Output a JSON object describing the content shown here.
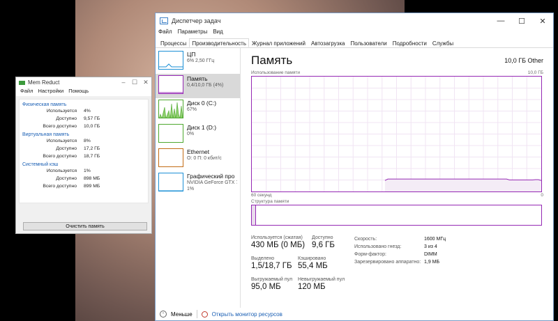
{
  "taskmgr": {
    "title": "Диспетчер задач",
    "menu": [
      "Файл",
      "Параметры",
      "Вид"
    ],
    "tabs": [
      "Процессы",
      "Производительность",
      "Журнал приложений",
      "Автозагрузка",
      "Пользователи",
      "Подробности",
      "Службы"
    ],
    "active_tab": "Производительность",
    "sidebar": [
      {
        "name": "ЦП",
        "sub": "6% 2,50 ГГц",
        "sub2": "",
        "color": "#1a8fd6"
      },
      {
        "name": "Память",
        "sub": "0,4/10,0 ГБ (4%)",
        "sub2": "",
        "color": "#9528b4"
      },
      {
        "name": "Диск 0 (C:)",
        "sub": "67%",
        "sub2": "",
        "color": "#4da82e"
      },
      {
        "name": "Диск 1 (D:)",
        "sub": "0%",
        "sub2": "",
        "color": "#4da82e"
      },
      {
        "name": "Ethernet",
        "sub": "О: 0 П: 0 кбит/с",
        "sub2": "",
        "color": "#c26b14"
      },
      {
        "name": "Графический про",
        "sub": "NVIDIA GeForce GTX 76(",
        "sub2": "1%",
        "color": "#1a8fd6"
      }
    ],
    "main": {
      "title": "Память",
      "capacity": "10,0 ГБ Other",
      "graph_label": "Использование памяти",
      "graph_max": "10,0 ГБ",
      "graph_time": "60 секунд",
      "graph_min": "0",
      "struct_label": "Структура памяти"
    },
    "stats": {
      "in_use_label": "Используется (сжатая)",
      "in_use_value": "430 МБ (0 МБ)",
      "available_label": "Доступно",
      "available_value": "9,6 ГБ",
      "committed_label": "Выделено",
      "committed_value": "1,5/18,7 ГБ",
      "cached_label": "Кэшировано",
      "cached_value": "55,4 МБ",
      "paged_label": "Выгружаемый пул",
      "paged_value": "95,0 МБ",
      "nonpaged_label": "Невыгружаемый пул",
      "nonpaged_value": "120 МБ"
    },
    "details": [
      {
        "k": "Скорость:",
        "v": "1600 МГц"
      },
      {
        "k": "Использовано гнезд:",
        "v": "3 из 4"
      },
      {
        "k": "Форм-фактор:",
        "v": "DIMM"
      },
      {
        "k": "Зарезервировано аппаратно:",
        "v": "1,9 МБ"
      }
    ],
    "footer": {
      "less": "Меньше",
      "monitor": "Открыть монитор ресурсов"
    }
  },
  "memreduct": {
    "title": "Mem Reduct",
    "menu": [
      "Файл",
      "Настройки",
      "Помощь"
    ],
    "sections": [
      {
        "title": "Физическая память",
        "rows": [
          {
            "k": "Используется",
            "v": "4%"
          },
          {
            "k": "Доступно",
            "v": "9,57 ГБ"
          },
          {
            "k": "Всего доступно",
            "v": "10,0 ГБ"
          }
        ]
      },
      {
        "title": "Виртуальная память",
        "rows": [
          {
            "k": "Используется",
            "v": "8%"
          },
          {
            "k": "Доступно",
            "v": "17,2 ГБ"
          },
          {
            "k": "Всего доступно",
            "v": "18,7 ГБ"
          }
        ]
      },
      {
        "title": "Системный кэш",
        "rows": [
          {
            "k": "Используется",
            "v": "1%"
          },
          {
            "k": "Доступно",
            "v": "898 МБ"
          },
          {
            "k": "Всего доступно",
            "v": "899 МБ"
          }
        ]
      }
    ],
    "button": "Очистить память"
  },
  "memory_history": [
    0.0,
    0.0,
    0.0,
    0.0,
    0.0,
    0.0,
    0.0,
    0.0,
    0.0,
    0.0,
    0.0,
    0.0,
    0.0,
    0.0,
    0.0,
    0.0,
    0.0,
    0.0,
    0.0,
    0.0,
    0.0,
    0.0,
    0.0,
    0.0,
    0.0,
    0.0,
    0.0,
    0.0,
    0.0,
    0.0,
    0.0,
    0.0,
    0.0,
    0.0,
    0.0,
    0.0,
    0.0,
    0.0,
    0.0,
    0.0,
    0.0,
    0.0,
    0.0,
    0.0,
    0.0,
    0.0,
    0.04,
    0.045,
    0.045,
    0.045,
    0.045,
    0.045,
    0.045,
    0.045,
    0.045,
    0.045,
    0.045,
    0.045,
    0.045,
    0.045,
    0.045,
    0.045,
    0.045,
    0.045,
    0.045,
    0.045,
    0.045,
    0.045,
    0.045,
    0.045,
    0.045,
    0.045,
    0.045,
    0.045,
    0.045,
    0.045,
    0.045,
    0.045,
    0.045,
    0.045,
    0.045,
    0.045,
    0.045,
    0.045,
    0.045,
    0.045,
    0.045,
    0.045,
    0.045,
    0.042,
    0.042,
    0.042,
    0.042,
    0.042,
    0.042,
    0.042,
    0.042,
    0.042,
    0.043,
    0.043,
    0.04
  ]
}
